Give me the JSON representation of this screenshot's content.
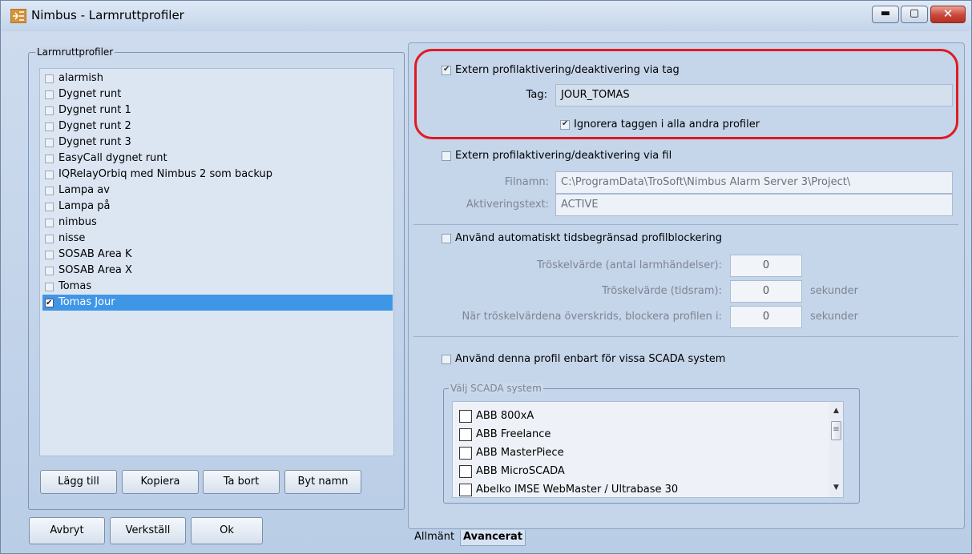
{
  "window": {
    "title": "Nimbus - Larmruttprofiler",
    "min_glyph": "▬",
    "max_glyph": "▢",
    "close_glyph": "✕"
  },
  "left": {
    "group_title": "Larmruttprofiler",
    "profiles": [
      {
        "label": "alarmish",
        "checked": false
      },
      {
        "label": "Dygnet runt",
        "checked": false
      },
      {
        "label": "Dygnet runt 1",
        "checked": false
      },
      {
        "label": "Dygnet runt 2",
        "checked": false
      },
      {
        "label": "Dygnet runt 3",
        "checked": false
      },
      {
        "label": "EasyCall dygnet runt",
        "checked": false
      },
      {
        "label": "IQRelayOrbiq med Nimbus 2 som backup",
        "checked": false
      },
      {
        "label": "Lampa av",
        "checked": false
      },
      {
        "label": "Lampa på",
        "checked": false
      },
      {
        "label": "nimbus",
        "checked": false
      },
      {
        "label": "nisse",
        "checked": false
      },
      {
        "label": "SOSAB Area K",
        "checked": false
      },
      {
        "label": "SOSAB Area X",
        "checked": false
      },
      {
        "label": "Tomas",
        "checked": false
      },
      {
        "label": "Tomas Jour",
        "checked": true,
        "selected": true
      }
    ],
    "buttons": {
      "add": "Lägg till",
      "copy": "Kopiera",
      "remove": "Ta bort",
      "rename": "Byt namn"
    }
  },
  "footer": {
    "cancel": "Avbryt",
    "apply": "Verkställ",
    "ok": "Ok"
  },
  "tag_section": {
    "checkbox_label": "Extern profilaktivering/deaktivering via tag",
    "checked": true,
    "tag_label": "Tag:",
    "tag_value": "JOUR_TOMAS",
    "ignore_label": "Ignorera taggen i alla andra profiler",
    "ignore_checked": true
  },
  "file_section": {
    "checkbox_label": "Extern profilaktivering/deaktivering via fil",
    "checked": false,
    "filename_label": "Filnamn:",
    "filename_value": "C:\\ProgramData\\TroSoft\\Nimbus Alarm Server 3\\Project\\",
    "activation_label": "Aktiveringstext:",
    "activation_value": "ACTIVE"
  },
  "block_section": {
    "checkbox_label": "Använd automatiskt tidsbegränsad profilblockering",
    "checked": false,
    "threshold_events_label": "Tröskelvärde (antal larmhändelser):",
    "threshold_events_value": "0",
    "threshold_time_label": "Tröskelvärde (tidsram):",
    "threshold_time_value": "0",
    "threshold_time_unit": "sekunder",
    "block_label": "När tröskelvärdena överskrids, blockera profilen i:",
    "block_value": "0",
    "block_unit": "sekunder"
  },
  "scada_section": {
    "checkbox_label": "Använd denna profil enbart för vissa SCADA system",
    "checked": false,
    "group_title": "Välj SCADA system",
    "systems": [
      "ABB 800xA",
      "ABB Freelance",
      "ABB MasterPiece",
      "ABB MicroSCADA",
      "Abelko IMSE WebMaster / Ultrabase 30"
    ],
    "scroll_up": "▲",
    "scroll_down": "▼",
    "thumb_glyph": "≡"
  },
  "tabs": {
    "general": "Allmänt",
    "advanced": "Avancerat"
  },
  "colors": {
    "highlight": "#e01a22",
    "selection": "#3f96e6"
  }
}
